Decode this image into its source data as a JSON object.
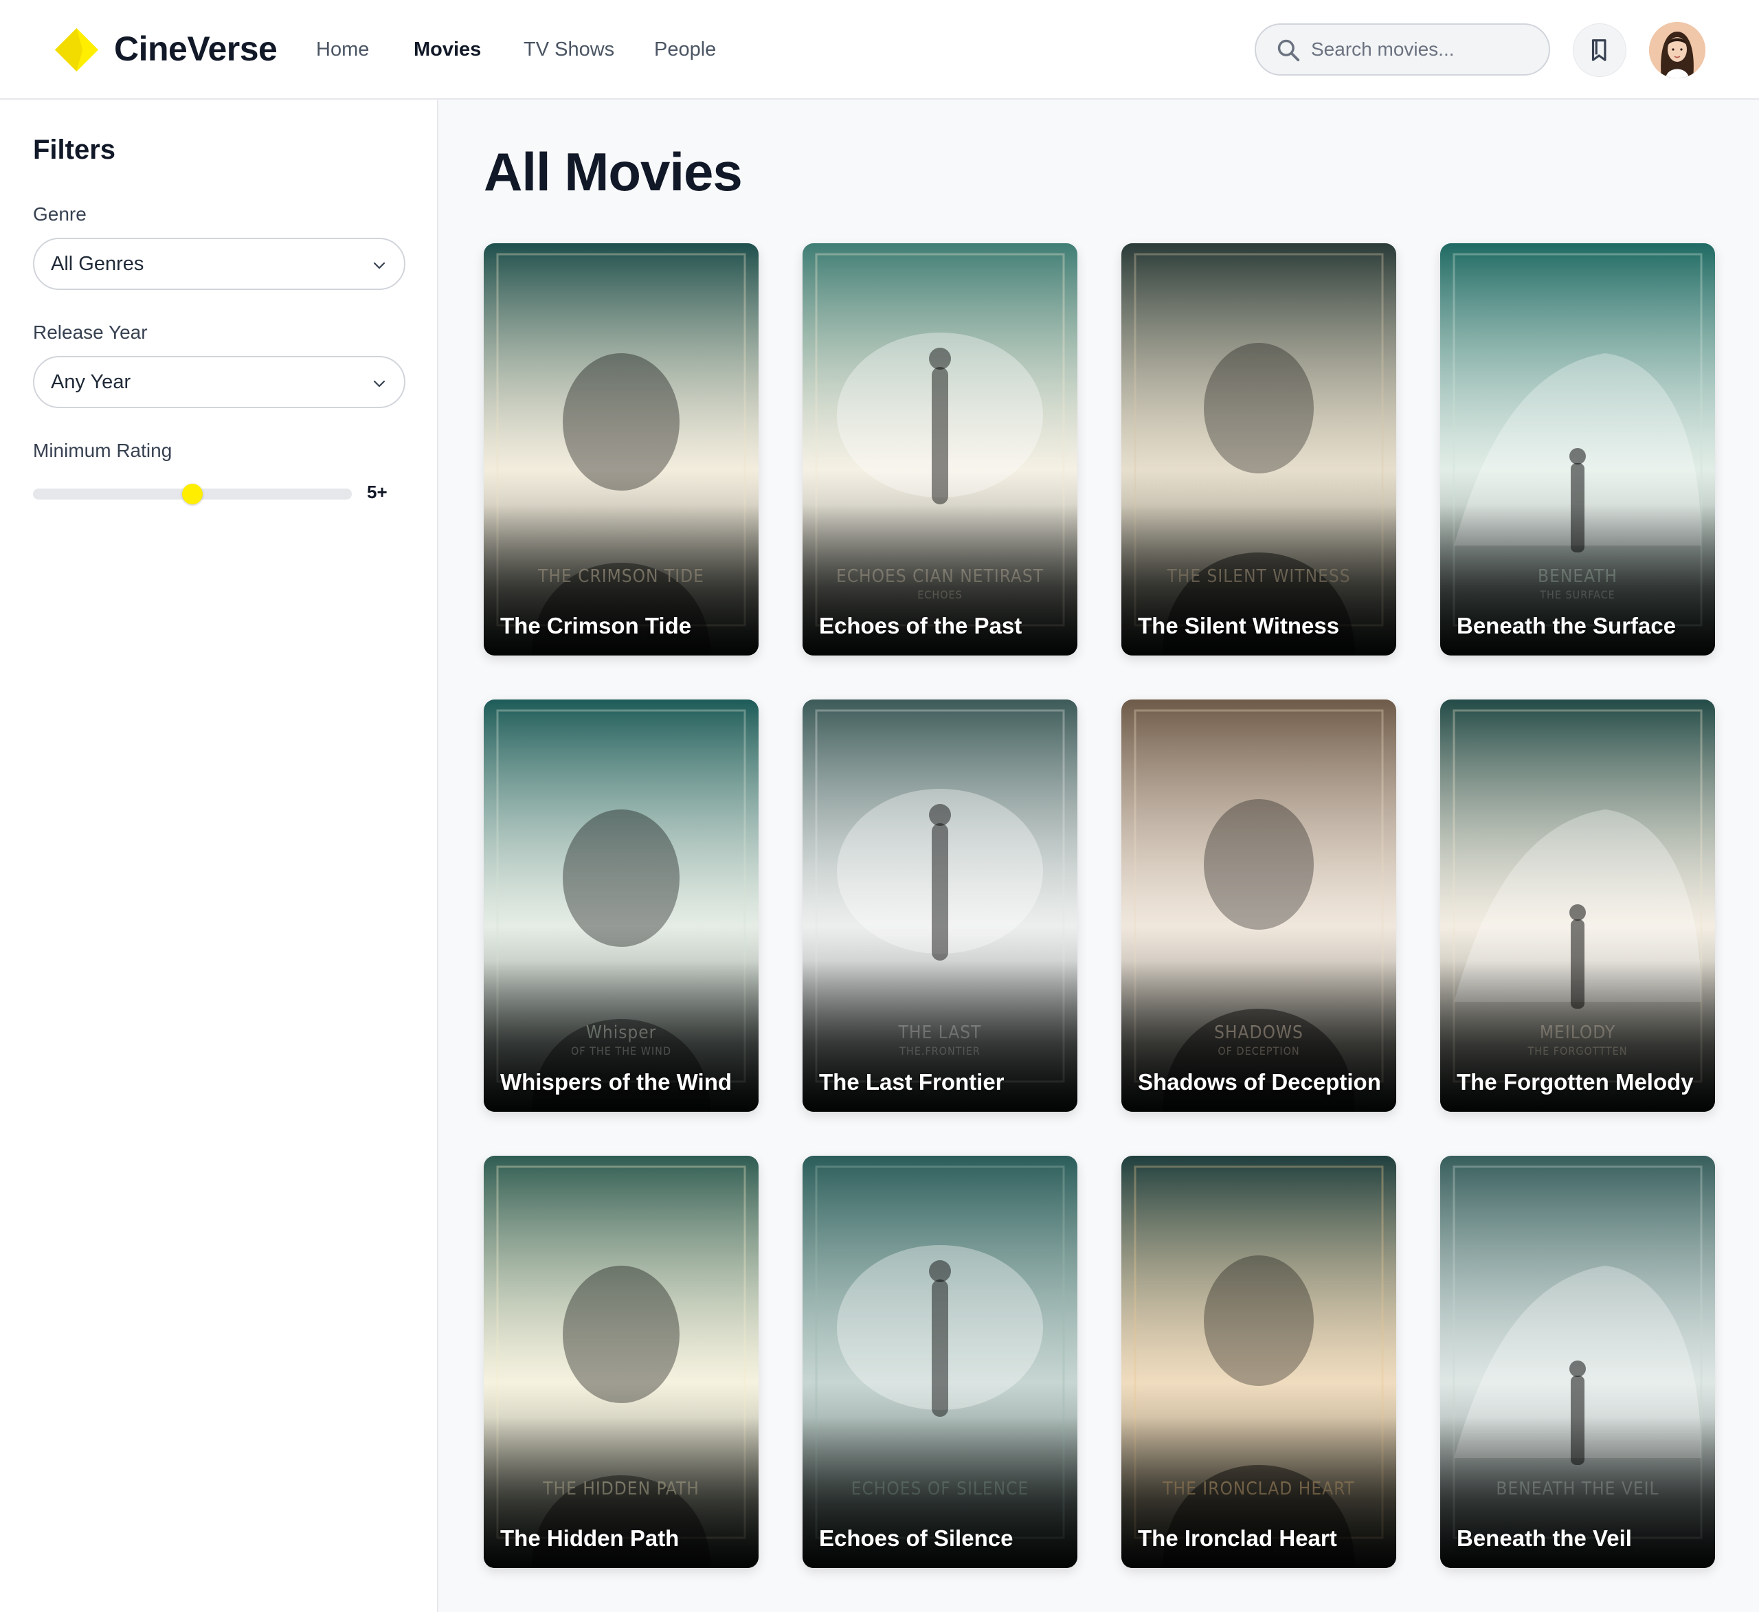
{
  "brand": {
    "name": "CineVerse",
    "logo_color": "#ffee00"
  },
  "nav": [
    {
      "label": "Home",
      "active": false
    },
    {
      "label": "Movies",
      "active": true
    },
    {
      "label": "TV Shows",
      "active": false
    },
    {
      "label": "People",
      "active": false
    }
  ],
  "search": {
    "placeholder": "Search movies...",
    "value": "",
    "icon": "search-icon"
  },
  "header_actions": {
    "watchlist_icon": "bookmark-icon",
    "avatar": "user-avatar"
  },
  "filters": {
    "title": "Filters",
    "genre": {
      "label": "Genre",
      "value": "All Genres"
    },
    "year": {
      "label": "Release Year",
      "value": "Any Year"
    },
    "rating": {
      "label": "Minimum Rating",
      "value": 5,
      "max": 10,
      "display": "5+"
    }
  },
  "main": {
    "title": "All Movies"
  },
  "movies": [
    {
      "title": "The Crimson Tide",
      "poster_text": "THE CRIMSON TIDE",
      "bg": "#1e4f4c",
      "accent": "#efe3c6"
    },
    {
      "title": "Echoes of the Past",
      "poster_text": "ECHOES CIAN NETIRAST",
      "poster_sub": "ECHOES",
      "bg": "#3f7d74",
      "accent": "#f2e9d2"
    },
    {
      "title": "The Silent Witness",
      "poster_text": "THE SILENT WITNESS",
      "bg": "#2a3b38",
      "accent": "#d9c9a8"
    },
    {
      "title": "Beneath the Surface",
      "poster_text": "BENEATH",
      "poster_sub": "THE SURFACE",
      "bg": "#1f6a63",
      "accent": "#cfe3d6"
    },
    {
      "title": "Whispers of the Wind",
      "poster_text": "Whisper",
      "poster_sub": "OF THE THE WIND",
      "bg": "#1d5b58",
      "accent": "#d6e3d4"
    },
    {
      "title": "The Last Frontier",
      "poster_text": "THE LAST",
      "poster_sub": "THE.FRONTIER",
      "bg": "#3c5a58",
      "accent": "#e3e6e2"
    },
    {
      "title": "Shadows of Deception",
      "poster_text": "SHADOWS",
      "poster_sub": "OF DECEPTION",
      "bg": "#6e5a48",
      "accent": "#ead9c4"
    },
    {
      "title": "The Forgotten Melody",
      "poster_text": "MEILODY",
      "poster_sub": "THE FORGOTTTEN",
      "bg": "#234b47",
      "accent": "#efe4cf"
    },
    {
      "title": "The Hidden Path",
      "poster_text": "THE HIDDEN PATH",
      "bg": "#2f5c52",
      "accent": "#f3ecc9"
    },
    {
      "title": "Echoes of Silence",
      "poster_text": "ECHOES OF SILENCE",
      "bg": "#2b5d5a",
      "accent": "#9fb9b0"
    },
    {
      "title": "The Ironclad Heart",
      "poster_text": "THE IRONCLAD HEART",
      "bg": "#1f3f3e",
      "accent": "#e9c58f"
    },
    {
      "title": "Beneath the Veil",
      "poster_text": "BENEATH THE VEIL",
      "bg": "#375e5c",
      "accent": "#c9d8d2"
    }
  ]
}
